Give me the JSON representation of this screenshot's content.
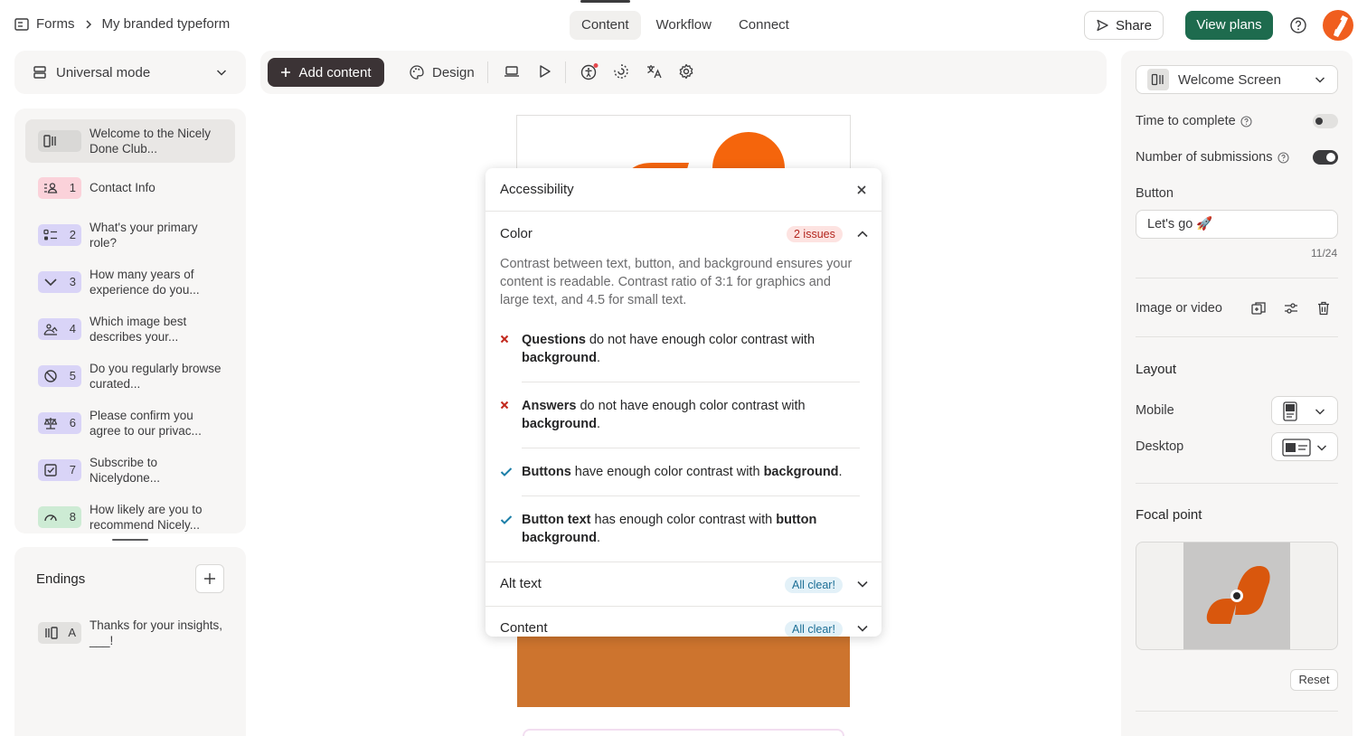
{
  "breadcrumb": {
    "root": "Forms",
    "current": "My branded typeform"
  },
  "nav_tabs": [
    {
      "label": "Content",
      "active": true
    },
    {
      "label": "Workflow",
      "active": false
    },
    {
      "label": "Connect",
      "active": false
    }
  ],
  "header_actions": {
    "share_label": "Share",
    "view_plans_label": "View plans"
  },
  "mode_selector": {
    "label": "Universal mode"
  },
  "toolbar": {
    "add_content_label": "Add content",
    "design_label": "Design"
  },
  "questions": [
    {
      "number": "",
      "text": "Welcome to the Nicely Done Club...",
      "icon": "welcome-screen-icon",
      "color": "#e9e7e5",
      "selected": true
    },
    {
      "number": "1",
      "text": "Contact Info",
      "icon": "contact-info-icon",
      "color": "#fbd2da"
    },
    {
      "number": "2",
      "text": "What's your primary role?",
      "icon": "multiple-choice-icon",
      "color": "#d9d4f7"
    },
    {
      "number": "3",
      "text": "How many years of experience do you...",
      "icon": "dropdown-icon",
      "color": "#d9d4f7"
    },
    {
      "number": "4",
      "text": "Which image best describes your...",
      "icon": "picture-choice-icon",
      "color": "#d9d4f7"
    },
    {
      "number": "5",
      "text": "Do you regularly browse curated...",
      "icon": "yes-no-icon",
      "color": "#d9d4f7"
    },
    {
      "number": "6",
      "text": "Please confirm you agree to our privac...",
      "icon": "legal-icon",
      "color": "#d9d4f7"
    },
    {
      "number": "7",
      "text": "Subscribe to Nicelydone...",
      "icon": "checkbox-icon",
      "color": "#d9d4f7"
    },
    {
      "number": "8",
      "text": "How likely are you to recommend Nicely...",
      "icon": "nps-gauge-icon",
      "color": "#cdebd4"
    }
  ],
  "endings": {
    "title": "Endings",
    "items": [
      {
        "letter": "A",
        "text": "Thanks for your insights, ___!",
        "icon": "ending-screen-icon"
      }
    ]
  },
  "accessibility": {
    "title": "Accessibility",
    "color_section": {
      "title": "Color",
      "badge": "2 issues",
      "description": "Contrast between text, button, and background ensures your content is readable. Contrast ratio of 3:1 for graphics and large text, and 4.5 for small text.",
      "items": [
        {
          "status": "fail",
          "bold1": "Questions",
          "mid": " do not have enough color contrast with ",
          "bold2": "background",
          "end": "."
        },
        {
          "status": "fail",
          "bold1": "Answers",
          "mid": " do not have enough color contrast with ",
          "bold2": "background",
          "end": "."
        },
        {
          "status": "pass",
          "bold1": "Buttons",
          "mid": " have enough color contrast with ",
          "bold2": "background",
          "end": "."
        },
        {
          "status": "pass",
          "bold1": "Button text",
          "mid": " has enough color contrast with ",
          "bold2": "button background",
          "end": "."
        }
      ]
    },
    "alt_text_section": {
      "title": "Alt text",
      "badge": "All clear!"
    },
    "content_section": {
      "title": "Content",
      "badge": "All clear!"
    }
  },
  "settings": {
    "screen_type": "Welcome Screen",
    "time_to_complete": {
      "label": "Time to complete",
      "enabled": false
    },
    "submissions": {
      "label": "Number of submissions",
      "enabled": true
    },
    "button": {
      "label": "Button",
      "value": "Let's go 🚀",
      "counter": "11/24"
    },
    "image_or_video_label": "Image or video",
    "layout": {
      "title": "Layout",
      "mobile_label": "Mobile",
      "desktop_label": "Desktop"
    },
    "focal_point": {
      "title": "Focal point",
      "reset_label": "Reset"
    }
  },
  "colors": {
    "brand_orange": "#f05e1f",
    "view_plans_green": "#1e6b4e",
    "fail_red": "#c2281d",
    "pass_blue": "#1c7fa8",
    "image_bottom": "#cd742e"
  }
}
